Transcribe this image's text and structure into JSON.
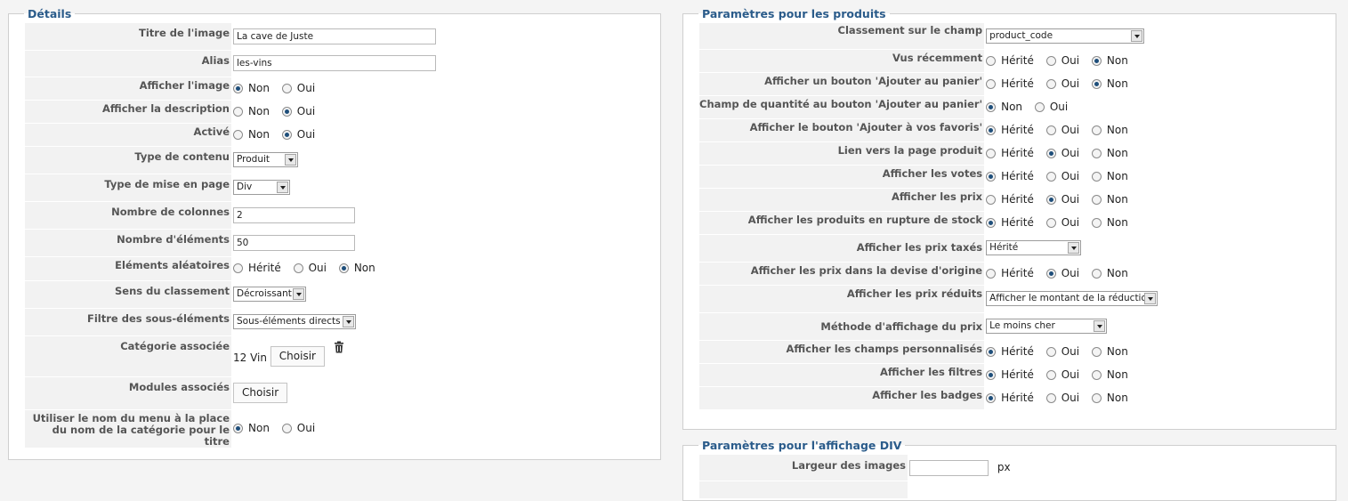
{
  "details": {
    "legend": "Détails",
    "rows": {
      "title": {
        "label": "Titre de l'image",
        "value": "La cave de Juste"
      },
      "alias": {
        "label": "Alias",
        "value": "les-vins"
      },
      "show_image": {
        "label": "Afficher l'image",
        "options": [
          "Non",
          "Oui"
        ],
        "selected": "Non"
      },
      "show_desc": {
        "label": "Afficher la description",
        "options": [
          "Non",
          "Oui"
        ],
        "selected": "Oui"
      },
      "active": {
        "label": "Activé",
        "options": [
          "Non",
          "Oui"
        ],
        "selected": "Oui"
      },
      "content_type": {
        "label": "Type de contenu",
        "value": "Produit"
      },
      "layout_type": {
        "label": "Type de mise en page",
        "value": "Div"
      },
      "columns": {
        "label": "Nombre de colonnes",
        "value": "2"
      },
      "elements": {
        "label": "Nombre d'éléments",
        "value": "50"
      },
      "random": {
        "label": "Eléments aléatoires",
        "options": [
          "Hérité",
          "Oui",
          "Non"
        ],
        "selected": "Non"
      },
      "sort_dir": {
        "label": "Sens du classement",
        "value": "Décroissant"
      },
      "sub_filter": {
        "label": "Filtre des sous-éléments",
        "value": "Sous-éléments directs"
      },
      "category": {
        "label": "Catégorie associée",
        "value": "12 Vin",
        "button": "Choisir"
      },
      "modules": {
        "label": "Modules associés",
        "button": "Choisir"
      },
      "menu_name": {
        "label": "Utiliser le nom du menu à la place du nom de la catégorie pour le titre",
        "options": [
          "Non",
          "Oui"
        ],
        "selected": "Non"
      }
    }
  },
  "products": {
    "legend": "Paramètres pour les produits",
    "rows": {
      "sort_field": {
        "label": "Classement sur le champ",
        "value": "product_code"
      },
      "recent": {
        "label": "Vus récemment",
        "options": [
          "Hérité",
          "Oui",
          "Non"
        ],
        "selected": "Non"
      },
      "cart_btn": {
        "label": "Afficher un bouton 'Ajouter au panier'",
        "options": [
          "Hérité",
          "Oui",
          "Non"
        ],
        "selected": "Non"
      },
      "qty_field": {
        "label": "Champ de quantité au bouton 'Ajouter au panier'",
        "options": [
          "Non",
          "Oui"
        ],
        "selected": "Non"
      },
      "fav_btn": {
        "label": "Afficher le bouton 'Ajouter à vos favoris'",
        "options": [
          "Hérité",
          "Oui",
          "Non"
        ],
        "selected": "Hérité"
      },
      "product_link": {
        "label": "Lien vers la page produit",
        "options": [
          "Hérité",
          "Oui",
          "Non"
        ],
        "selected": "Oui"
      },
      "votes": {
        "label": "Afficher les votes",
        "options": [
          "Hérité",
          "Oui",
          "Non"
        ],
        "selected": "Hérité"
      },
      "prices": {
        "label": "Afficher les prix",
        "options": [
          "Hérité",
          "Oui",
          "Non"
        ],
        "selected": "Oui"
      },
      "out_of_stock": {
        "label": "Afficher les produits en rupture de stock",
        "options": [
          "Hérité",
          "Oui",
          "Non"
        ],
        "selected": "Hérité"
      },
      "taxed": {
        "label": "Afficher les prix taxés",
        "value": "Hérité"
      },
      "orig_currency": {
        "label": "Afficher les prix dans la devise d'origine",
        "options": [
          "Hérité",
          "Oui",
          "Non"
        ],
        "selected": "Oui"
      },
      "discount": {
        "label": "Afficher les prix réduits",
        "value": "Afficher le montant de la réduction"
      },
      "price_method": {
        "label": "Méthode d'affichage du prix",
        "value": "Le moins cher"
      },
      "custom_fields": {
        "label": "Afficher les champs personnalisés",
        "options": [
          "Hérité",
          "Oui",
          "Non"
        ],
        "selected": "Hérité"
      },
      "filters": {
        "label": "Afficher les filtres",
        "options": [
          "Hérité",
          "Oui",
          "Non"
        ],
        "selected": "Hérité"
      },
      "badges": {
        "label": "Afficher les badges",
        "options": [
          "Hérité",
          "Oui",
          "Non"
        ],
        "selected": "Hérité"
      }
    }
  },
  "div_display": {
    "legend": "Paramètres pour l'affichage DIV",
    "image_width": {
      "label": "Largeur des images",
      "value": "",
      "unit": "px"
    }
  },
  "colors": {
    "legend": "#2a5b8a",
    "label_bg": "#f2f2f2",
    "radio_dot": "#1e4e7a"
  }
}
